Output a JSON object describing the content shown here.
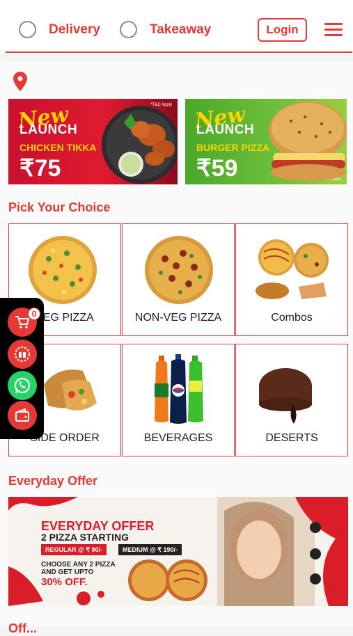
{
  "header": {
    "delivery_label": "Delivery",
    "takeaway_label": "Takeaway",
    "login_label": "Login"
  },
  "banners": [
    {
      "new": "New",
      "launch": "LAUNCH",
      "item": "CHICKEN TIKKA",
      "price": "₹75",
      "tm": "*T&C Apply"
    },
    {
      "new": "New",
      "launch": "LAUNCH",
      "item": "BURGER PIZZA",
      "price": "₹59",
      "tm": "*T&C Apply"
    }
  ],
  "pick_section": {
    "title": "Pick Your Choice",
    "items": [
      {
        "label": "VEG PIZZA"
      },
      {
        "label": "NON-VEG PIZZA"
      },
      {
        "label": "Combos"
      },
      {
        "label": "SIDE ORDER"
      },
      {
        "label": "BEVERAGES"
      },
      {
        "label": "DESERTS"
      }
    ]
  },
  "float_panel": {
    "cart_count": "0",
    "icons": [
      "cart-icon",
      "offer-icon",
      "whatsapp-icon",
      "wallet-icon"
    ]
  },
  "offer_section": {
    "title": "Everyday Offer",
    "banner": {
      "title": "EVERYDAY OFFER",
      "subtitle": "2 PIZZA STARTING",
      "regular": "REGULAR @ ₹ 90/-",
      "medium": "MEDIUM @ ₹ 190/-",
      "choose_line1": "CHOOSE ANY 2 PIZZA",
      "choose_line2": "AND GET UPTO",
      "off": "30% OFF."
    }
  },
  "next_section": {
    "title": "Off..."
  },
  "colors": {
    "brand_red": "#e53935",
    "whatsapp_green": "#25d366"
  }
}
